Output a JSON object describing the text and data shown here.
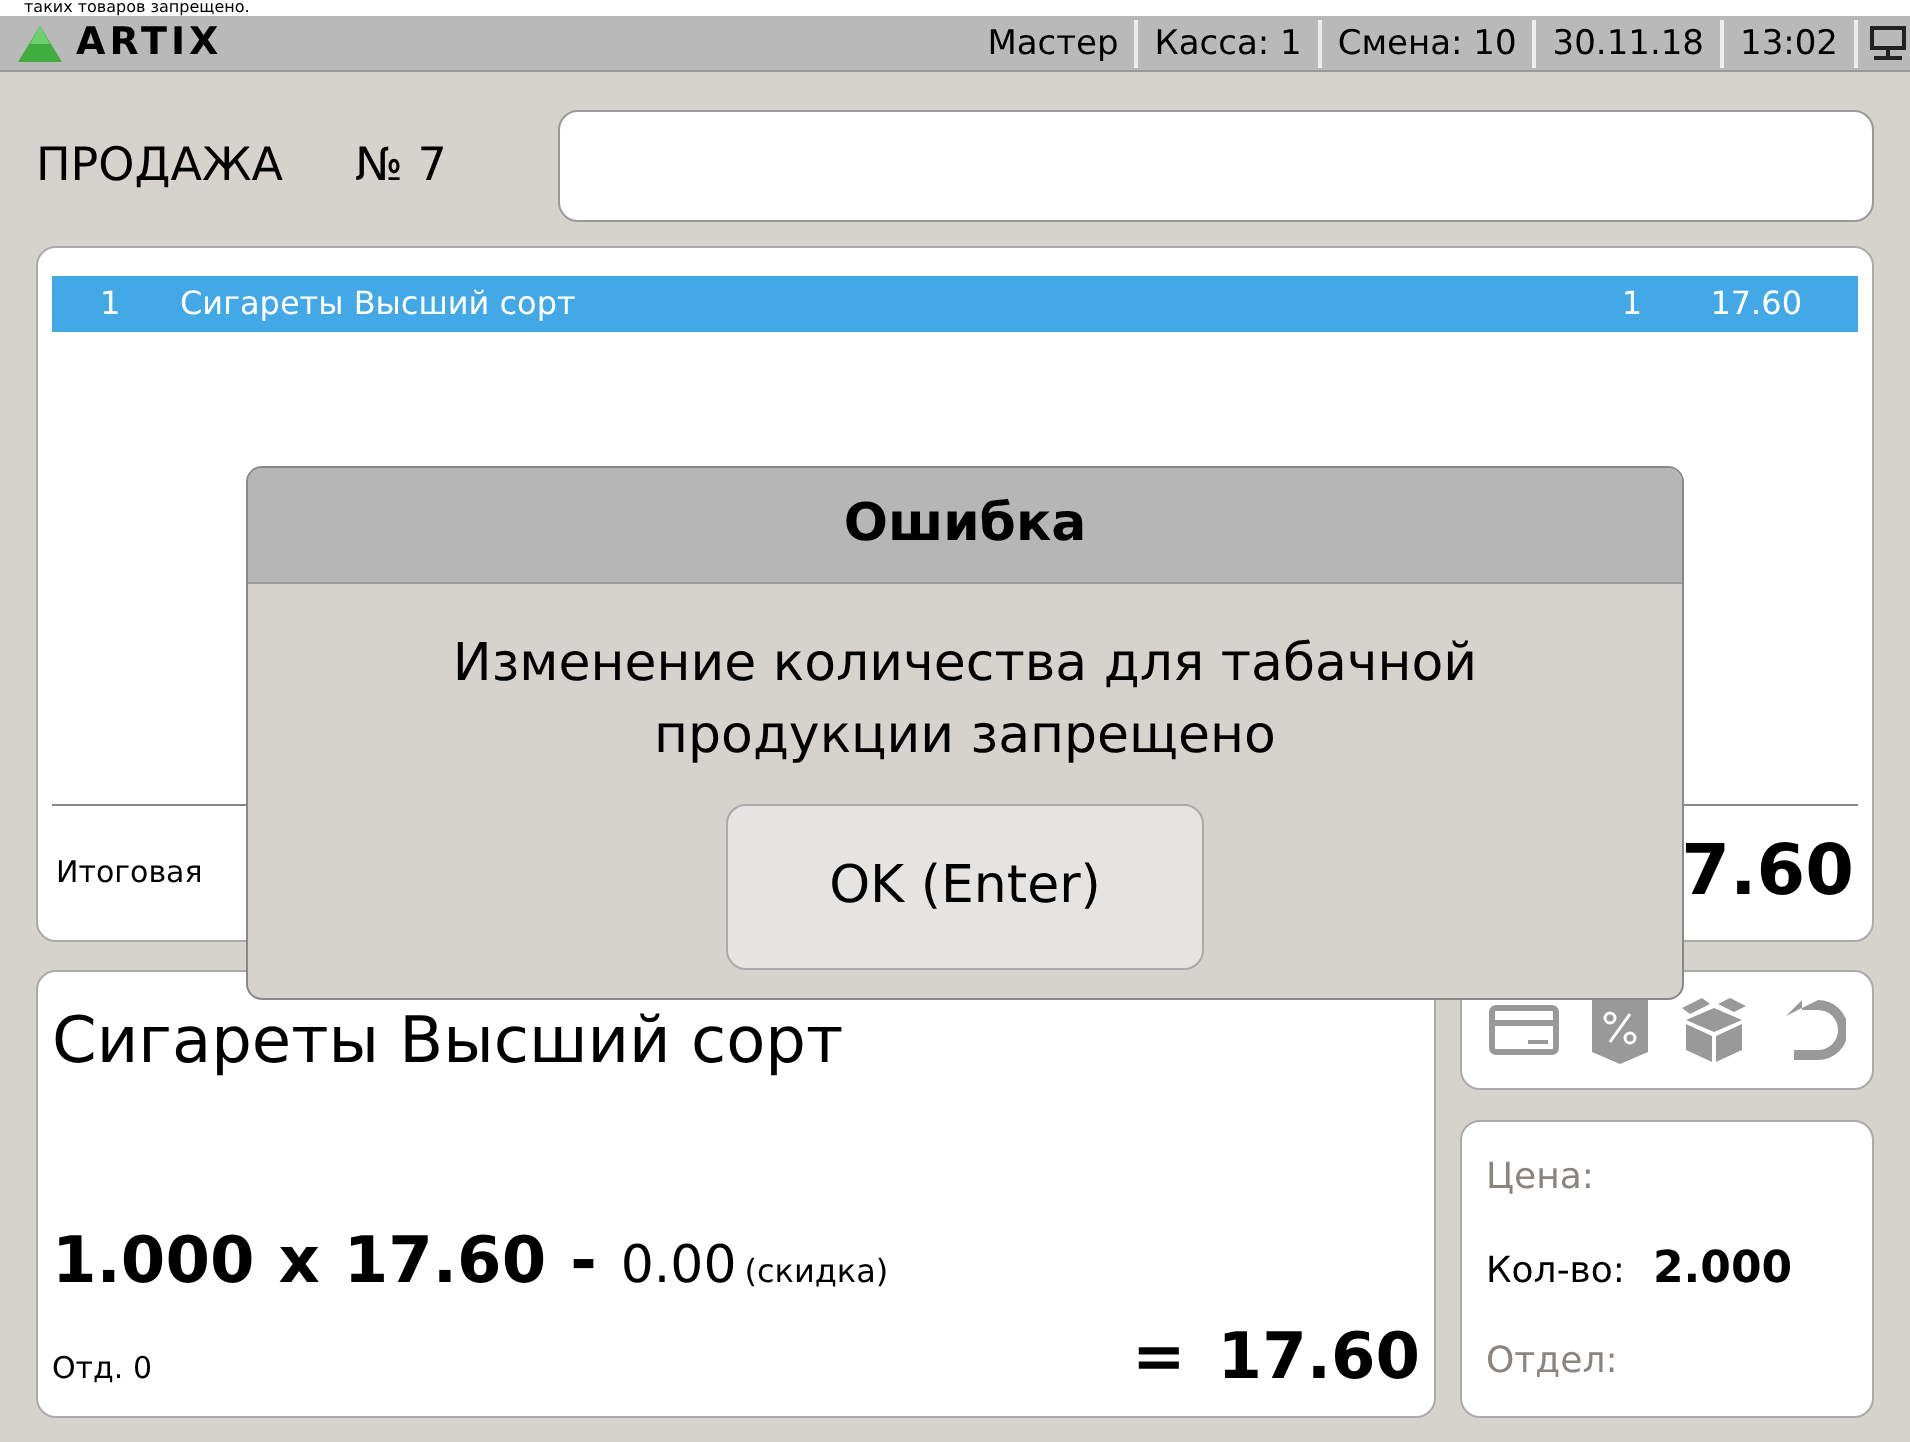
{
  "notice": "таких товаров запрещено.",
  "header": {
    "logo": "ARTIX",
    "status": [
      "Мастер",
      "Касса: 1",
      "Смена: 10",
      "30.11.18",
      "13:02"
    ]
  },
  "sale": {
    "title": "ПРОДАЖА",
    "number": "№ 7"
  },
  "receipt": {
    "rows": [
      {
        "index": "1",
        "name": "Сигареты Высший сорт",
        "qty": "1",
        "sum": "17.60",
        "selected": true
      }
    ],
    "total_label": "Итоговая",
    "total": "7.60"
  },
  "item": {
    "name": "Сигареты Высший сорт",
    "qty": "1.000",
    "times": "x",
    "price": "17.60",
    "minus": "-",
    "discount": "0.00",
    "discount_label": "(скидка)",
    "dept": "Отд. 0",
    "equals": "=",
    "sum": "17.60"
  },
  "info": [
    {
      "label": "Цена:",
      "active": false
    },
    {
      "label": "Кол-во:",
      "value": "2.000",
      "active": true
    },
    {
      "label": "Отдел:",
      "active": false
    }
  ],
  "dialog": {
    "title": "Ошибка",
    "message": "Изменение количества для табачной продукции запрещено",
    "button": "OK (Enter)"
  }
}
